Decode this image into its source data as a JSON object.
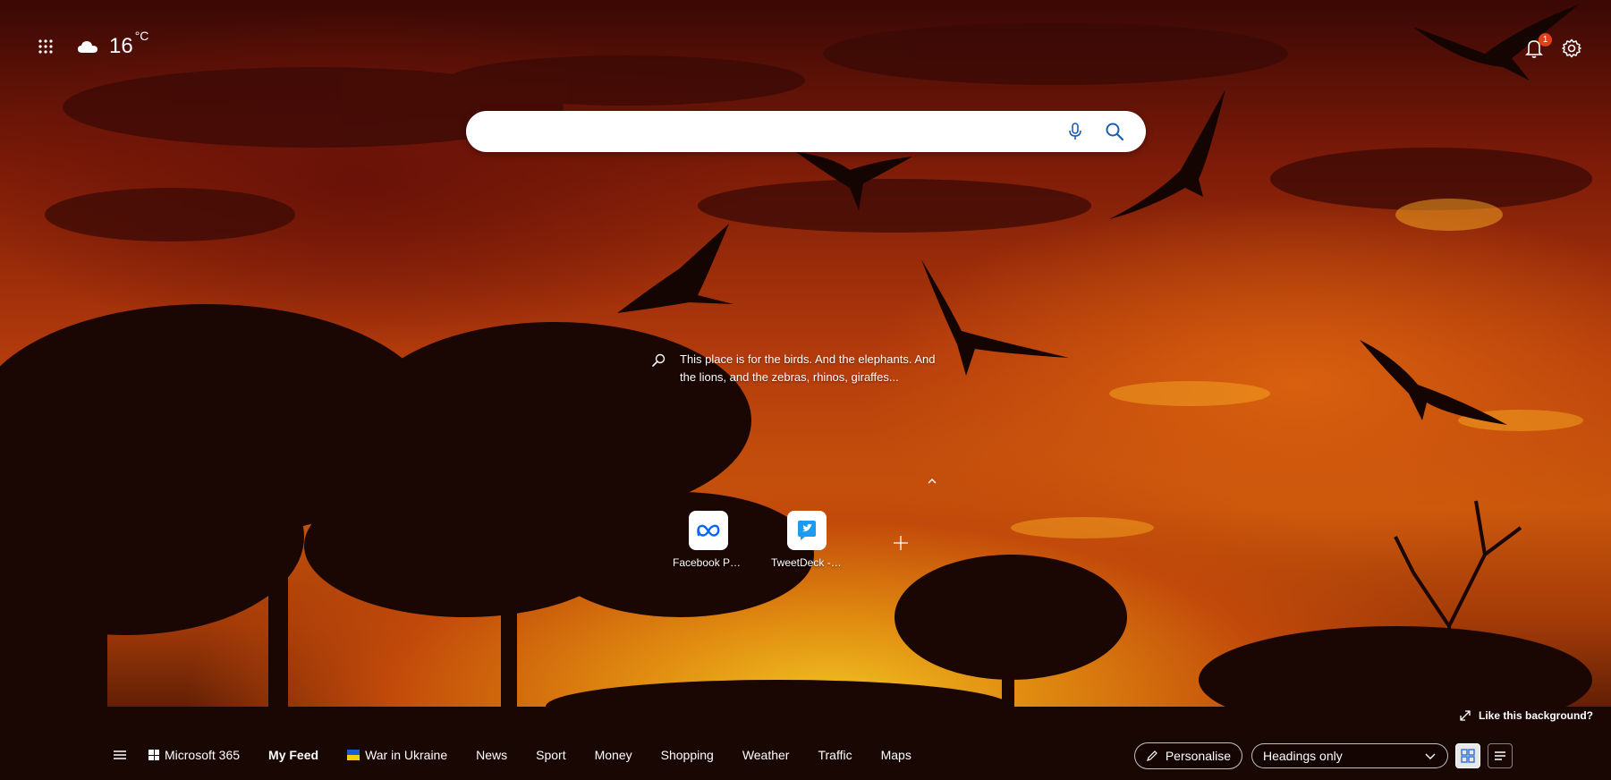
{
  "colors": {
    "sky_top": "#3a0805",
    "sky_mid": "#c9560c",
    "horizon_glow": "#f0c020",
    "silhouette": "#1a0603",
    "badge": "#e0401a",
    "accent": "#2b6fd6",
    "facebook_blue": "#0866ff",
    "twitter_blue": "#1d9bf0"
  },
  "top_left": {
    "apps_icon": "apps-grid-icon",
    "weather_icon": "cloud-icon",
    "temperature": "16",
    "unit": "°C"
  },
  "top_right": {
    "notification_count": "1",
    "bell_icon": "bell-icon",
    "settings_icon": "gear-icon"
  },
  "search": {
    "value": "",
    "placeholder": "",
    "mic_icon": "microphone-icon",
    "search_icon": "search-icon"
  },
  "image_caption": {
    "icon": "image-search-icon",
    "text": "This place is for the birds. And the elephants. And the lions, and the zebras, rhinos, giraffes..."
  },
  "quick_links": [
    {
      "label": "Facebook Pa...",
      "icon": "meta-icon"
    },
    {
      "label": "TweetDeck - ...",
      "icon": "tweetdeck-icon"
    }
  ],
  "add_link_icon": "plus-icon",
  "like_background": "Like this background?",
  "nav": {
    "items": [
      {
        "label": "Microsoft 365"
      },
      {
        "label": "My Feed"
      },
      {
        "label": "War in Ukraine"
      },
      {
        "label": "News"
      },
      {
        "label": "Sport"
      },
      {
        "label": "Money"
      },
      {
        "label": "Shopping"
      },
      {
        "label": "Weather"
      },
      {
        "label": "Traffic"
      },
      {
        "label": "Maps"
      }
    ],
    "active": "My Feed",
    "personalise": "Personalise",
    "layout_selected": "Headings only"
  }
}
